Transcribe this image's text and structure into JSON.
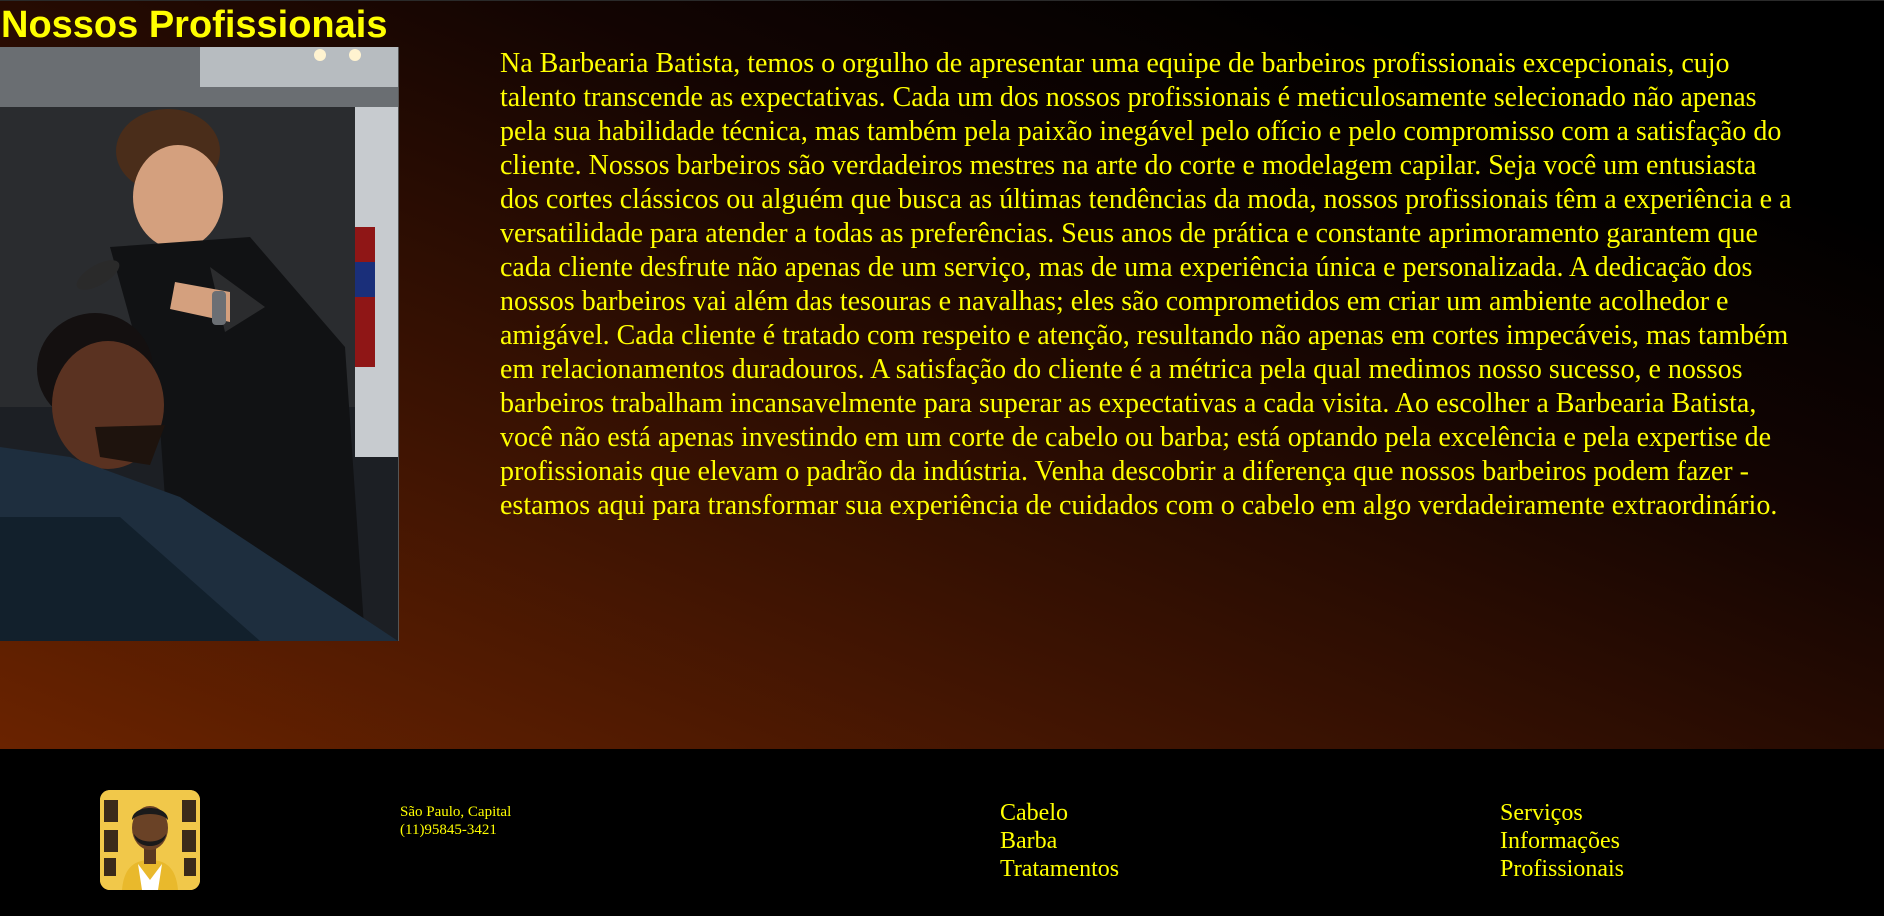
{
  "page": {
    "title": "Nossos Profissionais",
    "description": "Na Barbearia Batista, temos o orgulho de apresentar uma equipe de barbeiros profissionais excepcionais, cujo talento transcende as expectativas. Cada um dos nossos profissionais é meticulosamente selecionado não apenas pela sua habilidade técnica, mas também pela paixão inegável pelo ofício e pelo compromisso com a satisfação do cliente. Nossos barbeiros são verdadeiros mestres na arte do corte e modelagem capilar. Seja você um entusiasta dos cortes clássicos ou alguém que busca as últimas tendências da moda, nossos profissionais têm a experiência e a versatilidade para atender a todas as preferências. Seus anos de prática e constante aprimoramento garantem que cada cliente desfrute não apenas de um serviço, mas de uma experiência única e personalizada. A dedicação dos nossos barbeiros vai além das tesouras e navalhas; eles são comprometidos em criar um ambiente acolhedor e amigável. Cada cliente é tratado com respeito e atenção, resultando não apenas em cortes impecáveis, mas também em relacionamentos duradouros. A satisfação do cliente é a métrica pela qual medimos nosso sucesso, e nossos barbeiros trabalham incansavelmente para superar as expectativas a cada visita. Ao escolher a Barbearia Batista, você não está apenas investindo em um corte de cabelo ou barba; está optando pela excelência e pela expertise de profissionais que elevam o padrão da indústria. Venha descobrir a diferença que nossos barbeiros podem fazer - estamos aqui para transformar sua experiência de cuidados com o cabelo em algo verdadeiramente extraordinário."
  },
  "footer": {
    "contact": {
      "location": "São Paulo, Capital",
      "phone": "(11)95845-3421"
    },
    "services_links": [
      "Cabelo",
      "Barba",
      "Tratamentos"
    ],
    "site_links": [
      "Serviços",
      "Informações",
      "Profissionais"
    ]
  },
  "colors": {
    "text_accent": "#ffff00",
    "gradient_start": "#6a2300",
    "gradient_end": "#000000",
    "footer_bg": "#000000"
  }
}
